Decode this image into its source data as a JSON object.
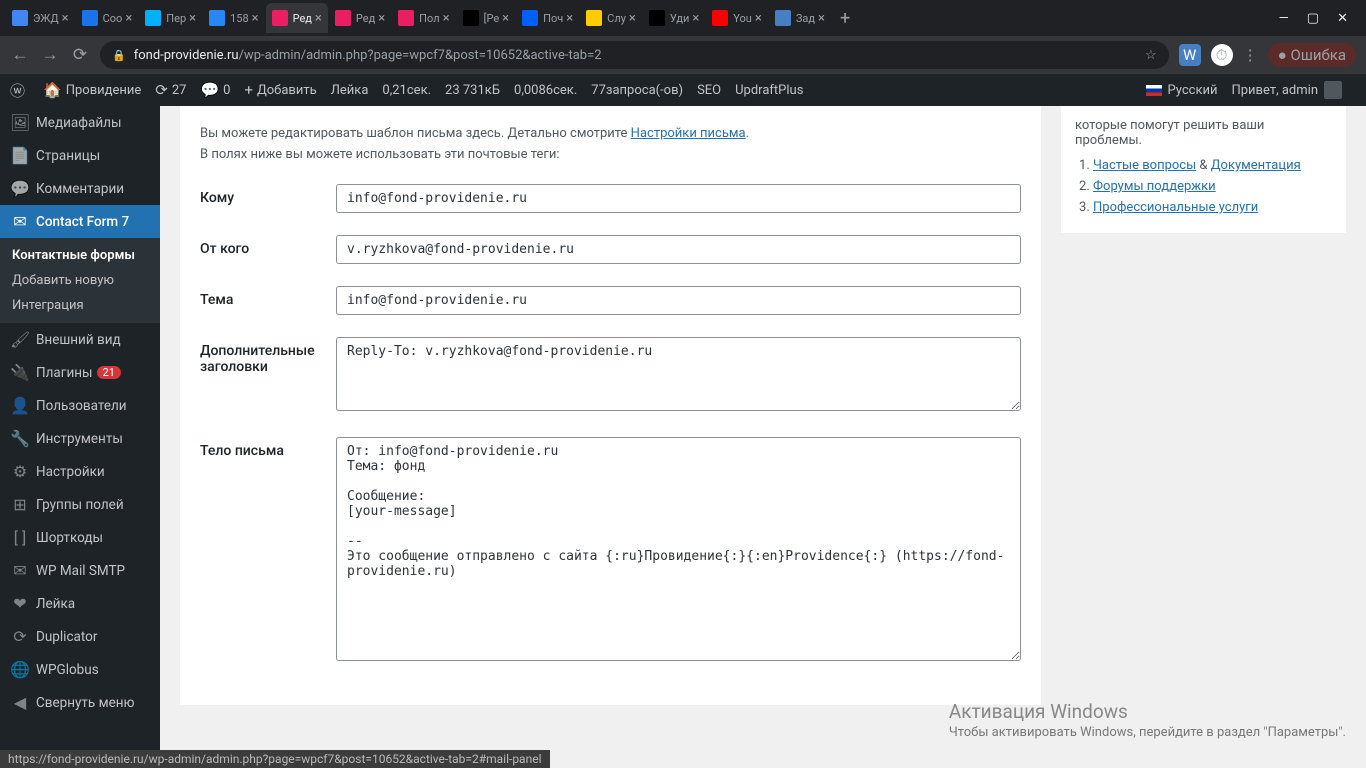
{
  "browser": {
    "tabs": [
      {
        "title": "ЭЖД",
        "favicon": "#4285f4"
      },
      {
        "title": "Coo",
        "favicon": "#1a73e8"
      },
      {
        "title": "Пер",
        "favicon": "#00b0ff"
      },
      {
        "title": "158",
        "favicon": "#2787f5"
      },
      {
        "title": "Ред",
        "favicon": "#e91e63",
        "active": true
      },
      {
        "title": "Ред",
        "favicon": "#e91e63"
      },
      {
        "title": "Пол",
        "favicon": "#e91e63"
      },
      {
        "title": "[Ре",
        "favicon": "#000"
      },
      {
        "title": "Поч",
        "favicon": "#005ff9"
      },
      {
        "title": "Слу",
        "favicon": "#fc0"
      },
      {
        "title": "Уди",
        "favicon": "#000"
      },
      {
        "title": "You",
        "favicon": "#f00"
      },
      {
        "title": "Зад",
        "favicon": "#4680c2"
      }
    ],
    "url_domain": "fond-providenie.ru",
    "url_path": "/wp-admin/admin.php?page=wpcf7&post=10652&active-tab=2",
    "error_label": "Ошибка"
  },
  "adminbar": {
    "site": "Провидение",
    "updates": "27",
    "comments": "0",
    "add": "Добавить",
    "leyka": "Лейка",
    "time": "0,21сек.",
    "size": "23 731кБ",
    "time2": "0,0086сек.",
    "queries": "77запроса(-ов)",
    "seo": "SEO",
    "updraft": "UpdraftPlus",
    "lang": "Русский",
    "greeting": "Привет, admin"
  },
  "sidebar": {
    "items": [
      {
        "icon": "🖼",
        "label": "Медиафайлы"
      },
      {
        "icon": "📄",
        "label": "Страницы"
      },
      {
        "icon": "💬",
        "label": "Комментарии"
      },
      {
        "icon": "✉",
        "label": "Contact Form 7",
        "current": true
      },
      {
        "icon": "🖌",
        "label": "Внешний вид"
      },
      {
        "icon": "🔌",
        "label": "Плагины",
        "badge": "21"
      },
      {
        "icon": "👤",
        "label": "Пользователи"
      },
      {
        "icon": "🔧",
        "label": "Инструменты"
      },
      {
        "icon": "⚙",
        "label": "Настройки"
      },
      {
        "icon": "⊞",
        "label": "Группы полей"
      },
      {
        "icon": "[ ]",
        "label": "Шорткоды"
      },
      {
        "icon": "✉",
        "label": "WP Mail SMTP"
      },
      {
        "icon": "❤",
        "label": "Лейка"
      },
      {
        "icon": "⟳",
        "label": "Duplicator"
      },
      {
        "icon": "🌐",
        "label": "WPGlobus"
      }
    ],
    "submenu": [
      {
        "label": "Контактные формы",
        "current": true
      },
      {
        "label": "Добавить новую"
      },
      {
        "label": "Интеграция"
      }
    ],
    "collapse": "Свернуть меню"
  },
  "content": {
    "intro1": "Вы можете редактировать шаблон письма здесь. Детально смотрите ",
    "intro_link": "Настройки письма",
    "intro2": "В полях ниже вы можете использовать эти почтовые теги:",
    "labels": {
      "to": "Кому",
      "from": "От кого",
      "subject": "Тема",
      "headers": "Дополнительные заголовки",
      "body": "Тело письма"
    },
    "values": {
      "to": "info@fond-providenie.ru",
      "from": "v.ryzhkova@fond-providenie.ru",
      "subject": "info@fond-providenie.ru",
      "headers": "Reply-To: v.ryzhkova@fond-providenie.ru",
      "body": "От: info@fond-providenie.ru\nТема: фонд\n\nСообщение:\n[your-message]\n\n--\nЭто сообщение отправлено с сайта {:ru}Провидение{:}{:en}Providence{:} (https://fond-providenie.ru)"
    }
  },
  "sidebox": {
    "text": "которые помогут решить ваши проблемы.",
    "faq": "Частые вопросы",
    "and": " & ",
    "docs": "Документация",
    "forums": "Форумы поддержки",
    "services": "Профессиональные услуги"
  },
  "statusbar": "https://fond-providenie.ru/wp-admin/admin.php?page=wpcf7&post=10652&active-tab=2#mail-panel",
  "watermark": {
    "title": "Активация Windows",
    "text": "Чтобы активировать Windows, перейдите в раздел \"Параметры\"."
  }
}
